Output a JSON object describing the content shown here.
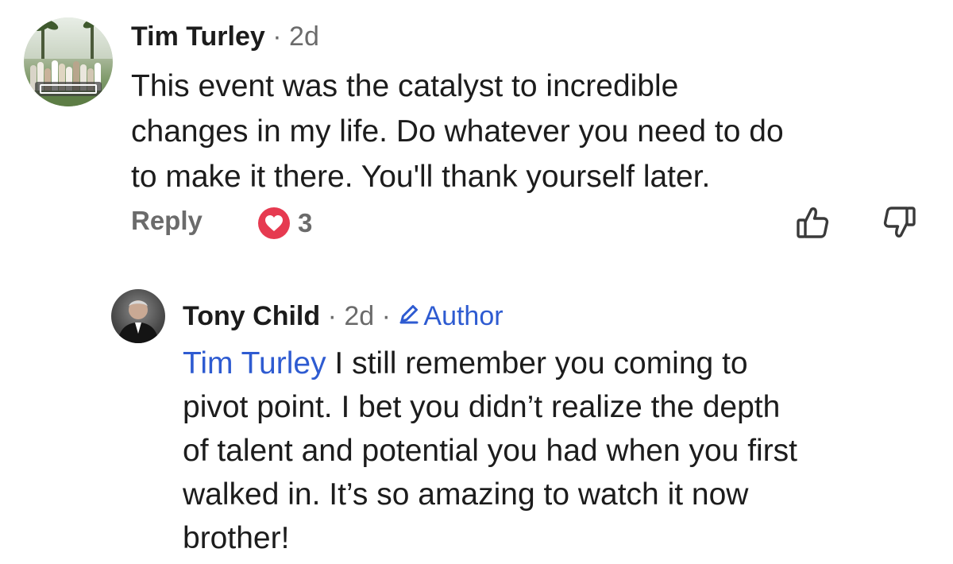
{
  "comment": {
    "author": "Tim Turley",
    "time": "2d",
    "lines": [
      "This event was the catalyst to incredible",
      "changes in my life.  Do whatever you need to do",
      "to make it there.  You'll thank yourself later."
    ],
    "actions": {
      "reply_label": "Reply",
      "reaction_count": "3",
      "reaction_icon": "heart-icon",
      "upvote_icon": "thumbs-up-icon",
      "downvote_icon": "thumbs-down-icon"
    }
  },
  "reply": {
    "author": "Tony Child",
    "time": "2d",
    "badge_label": "Author",
    "badge_icon": "pencil-icon",
    "mention": "Tim Turley",
    "line1_rest": " I still remember you coming to",
    "lines": [
      "pivot point. I bet you didn’t realize the depth",
      "of talent and potential you had when you first",
      "walked in. It’s so amazing to watch it now",
      "brother!"
    ]
  },
  "colors": {
    "link": "#2e5bd1",
    "heart": "#e63a50",
    "muted": "#6b6b6b"
  }
}
